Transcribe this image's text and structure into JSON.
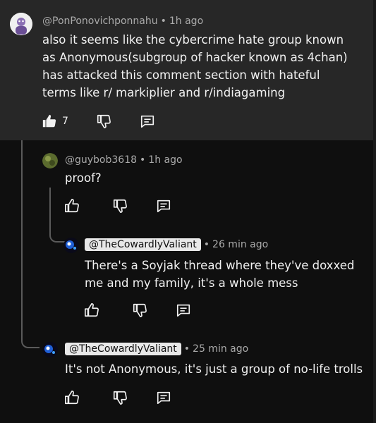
{
  "comments": [
    {
      "author": "@PonPonovichponnahu",
      "time": "1h ago",
      "text": "also it seems like the cybercrime hate group known as Anonymous(subgroup of hacker known as 4chan) has attacked this comment section with hateful terms like r/ markiplier and r/indiagaming",
      "likes": "7"
    },
    {
      "author": "@guybob3618",
      "time": "1h ago",
      "text": "proof?"
    },
    {
      "author": "@TheCowardlyValiant",
      "time": "26 min ago",
      "text": "There's a Soyjak thread where they've doxxed me and my family, it's a whole mess"
    },
    {
      "author": "@TheCowardlyValiant",
      "time": "25 min ago",
      "text": "It's not Anonymous, it's just a group of no-life trolls"
    }
  ],
  "separator": "•",
  "icons": {
    "like": "thumbs-up-icon",
    "dislike": "thumbs-down-icon",
    "reply": "reply-icon"
  },
  "colors": {
    "background": "#0f0f0f",
    "highlight": "#272727",
    "text": "#f1f1f1",
    "meta": "#aaaaaa",
    "chip_bg": "#e8e8e8"
  }
}
